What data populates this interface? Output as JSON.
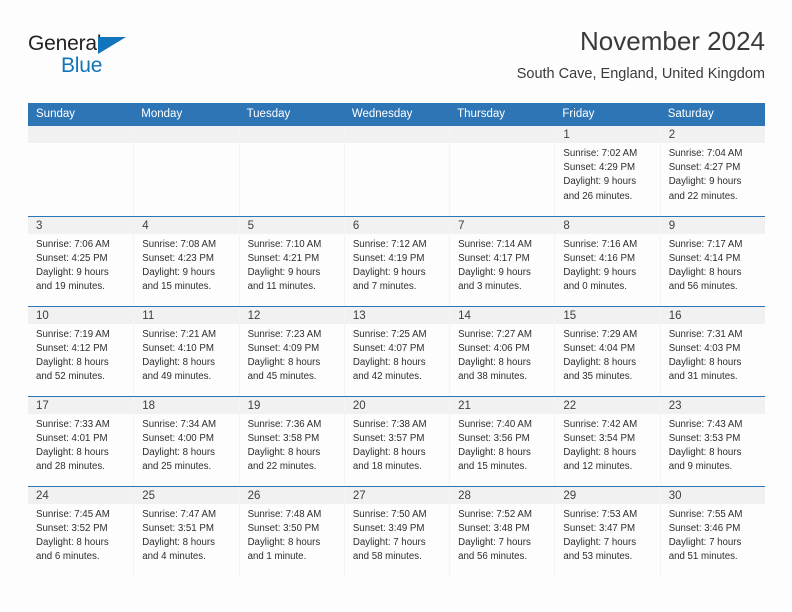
{
  "brand": {
    "name_part1": "General",
    "name_part2": "Blue",
    "logo_icon": "triangle-logo-icon",
    "color_dark": "#231f20",
    "color_blue": "#1175bb"
  },
  "header": {
    "title": "November 2024",
    "subtitle": "South Cave, England, United Kingdom"
  },
  "theme": {
    "header_blue": "#2e75b6",
    "day_band_gray": "#f1f1f1",
    "text": "#2e2e2e"
  },
  "calendar": {
    "weekday_headers": [
      "Sunday",
      "Monday",
      "Tuesday",
      "Wednesday",
      "Thursday",
      "Friday",
      "Saturday"
    ],
    "weeks": [
      [
        {
          "day": "",
          "empty": true,
          "lines": [
            "",
            "",
            "",
            ""
          ]
        },
        {
          "day": "",
          "empty": true,
          "lines": [
            "",
            "",
            "",
            ""
          ]
        },
        {
          "day": "",
          "empty": true,
          "lines": [
            "",
            "",
            "",
            ""
          ]
        },
        {
          "day": "",
          "empty": true,
          "lines": [
            "",
            "",
            "",
            ""
          ]
        },
        {
          "day": "",
          "empty": true,
          "lines": [
            "",
            "",
            "",
            ""
          ]
        },
        {
          "day": "1",
          "empty": false,
          "lines": [
            "Sunrise: 7:02 AM",
            "Sunset: 4:29 PM",
            "Daylight: 9 hours",
            "and 26 minutes."
          ]
        },
        {
          "day": "2",
          "empty": false,
          "lines": [
            "Sunrise: 7:04 AM",
            "Sunset: 4:27 PM",
            "Daylight: 9 hours",
            "and 22 minutes."
          ]
        }
      ],
      [
        {
          "day": "3",
          "empty": false,
          "lines": [
            "Sunrise: 7:06 AM",
            "Sunset: 4:25 PM",
            "Daylight: 9 hours",
            "and 19 minutes."
          ]
        },
        {
          "day": "4",
          "empty": false,
          "lines": [
            "Sunrise: 7:08 AM",
            "Sunset: 4:23 PM",
            "Daylight: 9 hours",
            "and 15 minutes."
          ]
        },
        {
          "day": "5",
          "empty": false,
          "lines": [
            "Sunrise: 7:10 AM",
            "Sunset: 4:21 PM",
            "Daylight: 9 hours",
            "and 11 minutes."
          ]
        },
        {
          "day": "6",
          "empty": false,
          "lines": [
            "Sunrise: 7:12 AM",
            "Sunset: 4:19 PM",
            "Daylight: 9 hours",
            "and 7 minutes."
          ]
        },
        {
          "day": "7",
          "empty": false,
          "lines": [
            "Sunrise: 7:14 AM",
            "Sunset: 4:17 PM",
            "Daylight: 9 hours",
            "and 3 minutes."
          ]
        },
        {
          "day": "8",
          "empty": false,
          "lines": [
            "Sunrise: 7:16 AM",
            "Sunset: 4:16 PM",
            "Daylight: 9 hours",
            "and 0 minutes."
          ]
        },
        {
          "day": "9",
          "empty": false,
          "lines": [
            "Sunrise: 7:17 AM",
            "Sunset: 4:14 PM",
            "Daylight: 8 hours",
            "and 56 minutes."
          ]
        }
      ],
      [
        {
          "day": "10",
          "empty": false,
          "lines": [
            "Sunrise: 7:19 AM",
            "Sunset: 4:12 PM",
            "Daylight: 8 hours",
            "and 52 minutes."
          ]
        },
        {
          "day": "11",
          "empty": false,
          "lines": [
            "Sunrise: 7:21 AM",
            "Sunset: 4:10 PM",
            "Daylight: 8 hours",
            "and 49 minutes."
          ]
        },
        {
          "day": "12",
          "empty": false,
          "lines": [
            "Sunrise: 7:23 AM",
            "Sunset: 4:09 PM",
            "Daylight: 8 hours",
            "and 45 minutes."
          ]
        },
        {
          "day": "13",
          "empty": false,
          "lines": [
            "Sunrise: 7:25 AM",
            "Sunset: 4:07 PM",
            "Daylight: 8 hours",
            "and 42 minutes."
          ]
        },
        {
          "day": "14",
          "empty": false,
          "lines": [
            "Sunrise: 7:27 AM",
            "Sunset: 4:06 PM",
            "Daylight: 8 hours",
            "and 38 minutes."
          ]
        },
        {
          "day": "15",
          "empty": false,
          "lines": [
            "Sunrise: 7:29 AM",
            "Sunset: 4:04 PM",
            "Daylight: 8 hours",
            "and 35 minutes."
          ]
        },
        {
          "day": "16",
          "empty": false,
          "lines": [
            "Sunrise: 7:31 AM",
            "Sunset: 4:03 PM",
            "Daylight: 8 hours",
            "and 31 minutes."
          ]
        }
      ],
      [
        {
          "day": "17",
          "empty": false,
          "lines": [
            "Sunrise: 7:33 AM",
            "Sunset: 4:01 PM",
            "Daylight: 8 hours",
            "and 28 minutes."
          ]
        },
        {
          "day": "18",
          "empty": false,
          "lines": [
            "Sunrise: 7:34 AM",
            "Sunset: 4:00 PM",
            "Daylight: 8 hours",
            "and 25 minutes."
          ]
        },
        {
          "day": "19",
          "empty": false,
          "lines": [
            "Sunrise: 7:36 AM",
            "Sunset: 3:58 PM",
            "Daylight: 8 hours",
            "and 22 minutes."
          ]
        },
        {
          "day": "20",
          "empty": false,
          "lines": [
            "Sunrise: 7:38 AM",
            "Sunset: 3:57 PM",
            "Daylight: 8 hours",
            "and 18 minutes."
          ]
        },
        {
          "day": "21",
          "empty": false,
          "lines": [
            "Sunrise: 7:40 AM",
            "Sunset: 3:56 PM",
            "Daylight: 8 hours",
            "and 15 minutes."
          ]
        },
        {
          "day": "22",
          "empty": false,
          "lines": [
            "Sunrise: 7:42 AM",
            "Sunset: 3:54 PM",
            "Daylight: 8 hours",
            "and 12 minutes."
          ]
        },
        {
          "day": "23",
          "empty": false,
          "lines": [
            "Sunrise: 7:43 AM",
            "Sunset: 3:53 PM",
            "Daylight: 8 hours",
            "and 9 minutes."
          ]
        }
      ],
      [
        {
          "day": "24",
          "empty": false,
          "lines": [
            "Sunrise: 7:45 AM",
            "Sunset: 3:52 PM",
            "Daylight: 8 hours",
            "and 6 minutes."
          ]
        },
        {
          "day": "25",
          "empty": false,
          "lines": [
            "Sunrise: 7:47 AM",
            "Sunset: 3:51 PM",
            "Daylight: 8 hours",
            "and 4 minutes."
          ]
        },
        {
          "day": "26",
          "empty": false,
          "lines": [
            "Sunrise: 7:48 AM",
            "Sunset: 3:50 PM",
            "Daylight: 8 hours",
            "and 1 minute."
          ]
        },
        {
          "day": "27",
          "empty": false,
          "lines": [
            "Sunrise: 7:50 AM",
            "Sunset: 3:49 PM",
            "Daylight: 7 hours",
            "and 58 minutes."
          ]
        },
        {
          "day": "28",
          "empty": false,
          "lines": [
            "Sunrise: 7:52 AM",
            "Sunset: 3:48 PM",
            "Daylight: 7 hours",
            "and 56 minutes."
          ]
        },
        {
          "day": "29",
          "empty": false,
          "lines": [
            "Sunrise: 7:53 AM",
            "Sunset: 3:47 PM",
            "Daylight: 7 hours",
            "and 53 minutes."
          ]
        },
        {
          "day": "30",
          "empty": false,
          "lines": [
            "Sunrise: 7:55 AM",
            "Sunset: 3:46 PM",
            "Daylight: 7 hours",
            "and 51 minutes."
          ]
        }
      ]
    ]
  }
}
